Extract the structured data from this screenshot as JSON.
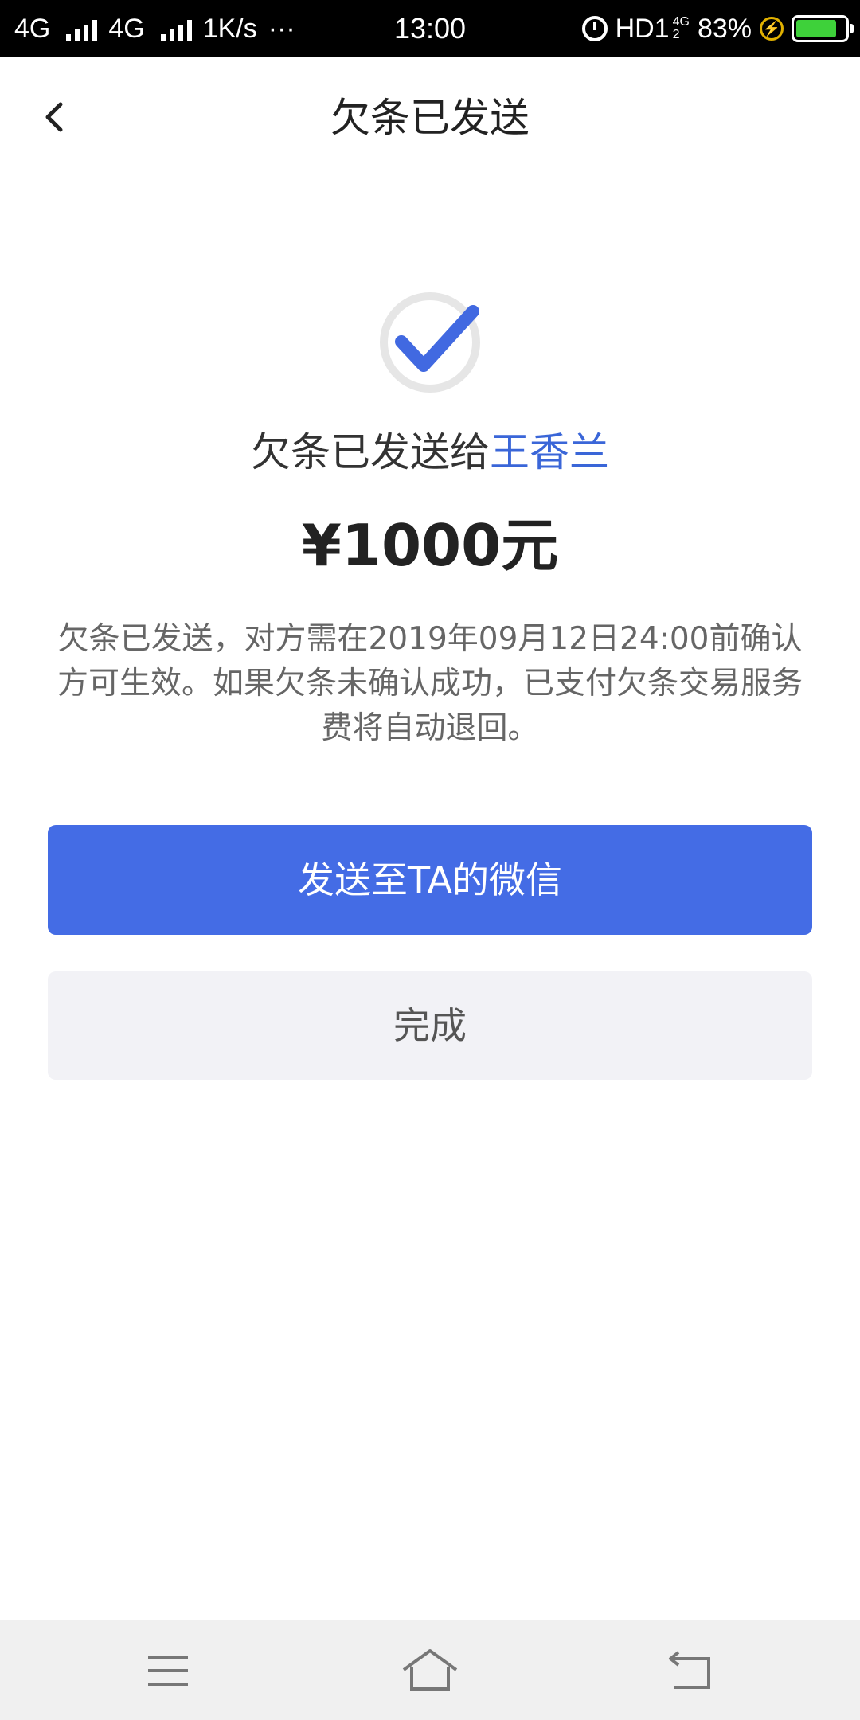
{
  "status_bar": {
    "network1": "4G",
    "network2": "4G",
    "speed": "1K/s",
    "more": "···",
    "time": "13:00",
    "hd": "HD1",
    "net_small": "4G",
    "net_small_sub": "2",
    "battery_percent": "83%",
    "battery_level": 0.83,
    "alarm_icon": "alarm-icon",
    "charging_icon": "charging-icon"
  },
  "nav": {
    "title": "欠条已发送",
    "back_icon": "chevron-left-icon"
  },
  "result": {
    "icon": "check-circle-icon",
    "sent_prefix": "欠条已发送给",
    "recipient": "王香兰",
    "amount": "¥1000元",
    "description": "欠条已发送，对方需在2019年09月12日24:00前确认方可生效。如果欠条未确认成功，已支付欠条交易服务费将自动退回。"
  },
  "actions": {
    "send_wechat": "发送至TA的微信",
    "done": "完成"
  },
  "system_nav": {
    "menu_icon": "menu-icon",
    "home_icon": "home-icon",
    "back_icon": "back-icon"
  },
  "colors": {
    "accent": "#446ce5",
    "recipient": "#3a66d8",
    "secondary_bg": "#f2f2f6",
    "battery": "#3ed13a"
  }
}
